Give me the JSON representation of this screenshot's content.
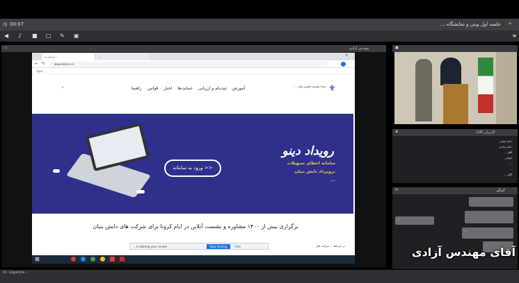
{
  "window": {
    "time": "00:07",
    "title": "جلسه اول ویتن و نمایشگاه ..."
  },
  "browser": {
    "tab1": "ارزیابی و ...",
    "tab2": "...",
    "url": "www.dana-e.ir",
    "bookmarks": "Apps   ..."
  },
  "site": {
    "org_name": "ستاد توسعه فناوری های ...",
    "nav": [
      "آموزش",
      "ثبت‌نام و ارزیابی",
      "حمایت‌ها",
      "اخبار",
      "قوانین",
      "راهنما"
    ],
    "hero_title": "رویداد دینو",
    "hero_sub1": "سامانه اعطای تسهیلات",
    "hero_sub2": "برویرداد دانش بنیان",
    "hero_sub3": "...",
    "enter_button": "ورود به سامانه >>",
    "headline": "برگزاری بیش از ۱۴۰۰ مشاوره و نشست آنلاین در ایام کرونا برای شرکت های دانش بنیان",
    "body_snippet": "در شرایط ... شرکت های"
  },
  "share_banner": {
    "text": "... is sharing your screen",
    "stop": "Stop sharing",
    "hide": "Hide"
  },
  "panels": {
    "share_title": "مهندس آزادی",
    "participants_title": "کاربران (18)",
    "participants": [
      "خانم ایوانی",
      "خانم ساعی",
      "آقای ...",
      "کیوانی",
      "...",
      "...",
      "آقای ..."
    ],
    "chat_title": "گفتگو"
  },
  "chat": [
    "...",
    "...",
    "...",
    "...",
    "..."
  ],
  "caption": "آقای مهندس آزادی",
  "statusbar": {
    "left": "ID: Gigabyte..."
  }
}
